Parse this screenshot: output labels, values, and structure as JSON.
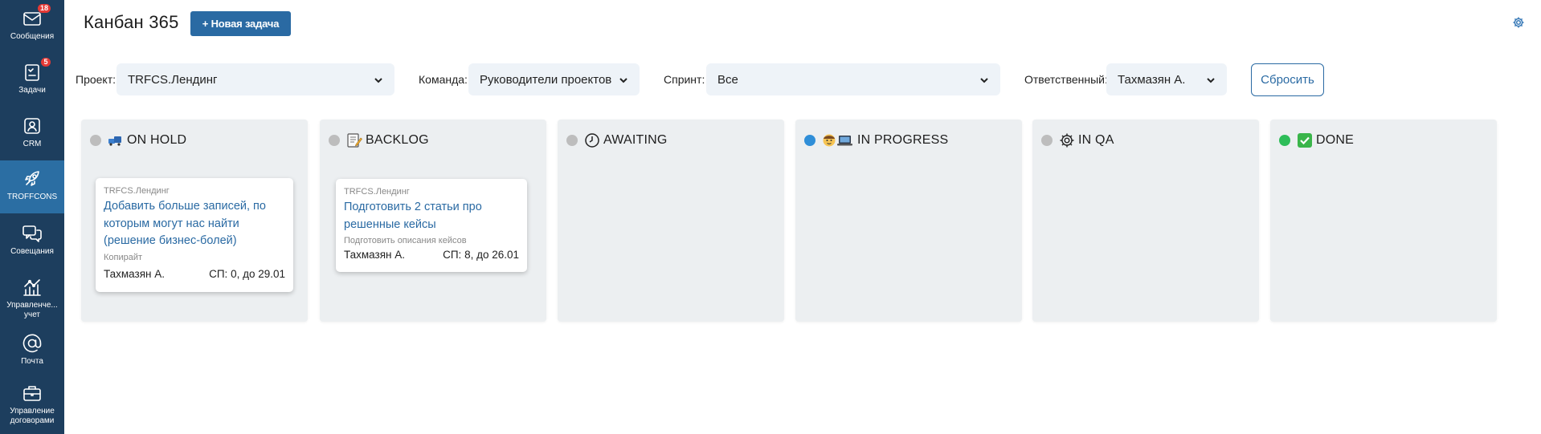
{
  "sidebar": {
    "items": [
      {
        "label": "Сообщения",
        "icon": "envelope-icon",
        "badge": "18"
      },
      {
        "label": "Задачи",
        "icon": "tasks-icon",
        "badge": "5"
      },
      {
        "label": "CRM",
        "icon": "crm-icon",
        "badge": ""
      },
      {
        "label": "TROFFCONS",
        "icon": "rocket-icon",
        "badge": "",
        "active": true
      },
      {
        "label": "Совещания",
        "icon": "chat-bubbles-icon",
        "badge": ""
      },
      {
        "label": "Управленче... учет",
        "icon": "chart-icon",
        "badge": ""
      },
      {
        "label": "Почта",
        "icon": "at-icon",
        "badge": ""
      },
      {
        "label": "Управление договорами",
        "icon": "briefcase-icon",
        "badge": ""
      }
    ]
  },
  "header": {
    "title": "Канбан 365",
    "new_task_label": "+ Новая задача"
  },
  "filters": {
    "project_label": "Проект:",
    "project_value": "TRFCS.Лендинг",
    "team_label": "Команда:",
    "team_value": "Руководители проектов",
    "sprint_label": "Спринт:",
    "sprint_value": "Все",
    "assignee_label": "Ответственный:",
    "assignee_value": "Тахмазян А.",
    "reset_label": "Сбросить"
  },
  "columns": [
    {
      "title": "ON HOLD",
      "icon": "hold-emoji",
      "dot_color": "#bdbdbd"
    },
    {
      "title": "BACKLOG",
      "icon": "memo-emoji",
      "dot_color": "#bdbdbd"
    },
    {
      "title": "AWAITING",
      "icon": "clock-icon",
      "dot_color": "#bdbdbd"
    },
    {
      "title": "IN PROGRESS",
      "icon": "developer-emoji",
      "dot_color": "#2f8ed8"
    },
    {
      "title": "IN QA",
      "icon": "gear-icon",
      "dot_color": "#bdbdbd"
    },
    {
      "title": "DONE",
      "icon": "check-emoji",
      "dot_color": "#2ebd59"
    }
  ],
  "cards": [
    {
      "project": "TRFCS.Лендинг",
      "title": "Добавить больше записей, по которым могут нас найти (решение бизнес-болей)",
      "meta": "Копирайт",
      "assignee": "Тахмазян А.",
      "sprint_due": "СП: 0, до 29.01"
    },
    {
      "project": "TRFCS.Лендинг",
      "title": "Подготовить 2 статьи про решенные кейсы",
      "meta": "Подготовить описания кейсов",
      "assignee": "Тахмазян А.",
      "sprint_due": "СП: 8, до 26.01"
    }
  ]
}
